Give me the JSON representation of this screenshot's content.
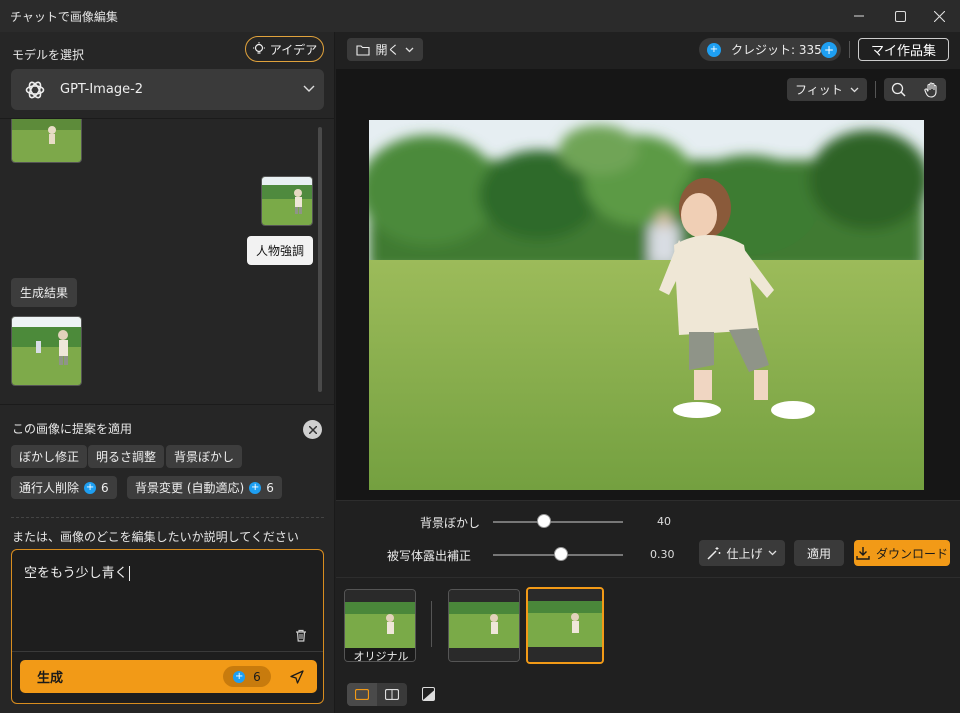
{
  "window": {
    "title": "チャットで画像編集"
  },
  "left": {
    "model_label": "モデルを選択",
    "idea_button": "アイデア",
    "model_name": "GPT-Image-2",
    "user_message_tag": "人物強調",
    "result_label": "生成結果",
    "suggest_title": "この画像に提案を適用",
    "chips": [
      {
        "label": "ぼかし修正"
      },
      {
        "label": "明るさ調整"
      },
      {
        "label": "背景ぼかし"
      },
      {
        "label": "通行人削除",
        "cost": "6"
      },
      {
        "label": "背景変更 (自動適応)",
        "cost": "6"
      }
    ],
    "describe_label": "または、画像のどこを編集したいか説明してください",
    "prompt_value": "空をもう少し青く",
    "generate_label": "生成",
    "generate_cost": "6"
  },
  "toolbar": {
    "open_label": "開く",
    "credits_label": "クレジット: 3353",
    "my_works_label": "マイ作品集",
    "fit_label": "フィット"
  },
  "adjust": {
    "bg_blur_label": "背景ぼかし",
    "bg_blur_value": "40",
    "subject_exposure_label": "被写体露出補正",
    "subject_exposure_value": "0.30",
    "finish_label": "仕上げ",
    "apply_label": "適用",
    "download_label": "ダウンロード"
  },
  "filmstrip": {
    "original_label": "オリジナル"
  },
  "colors": {
    "accent": "#f29a17",
    "credit": "#1e9ff2",
    "panel": "#262626"
  }
}
